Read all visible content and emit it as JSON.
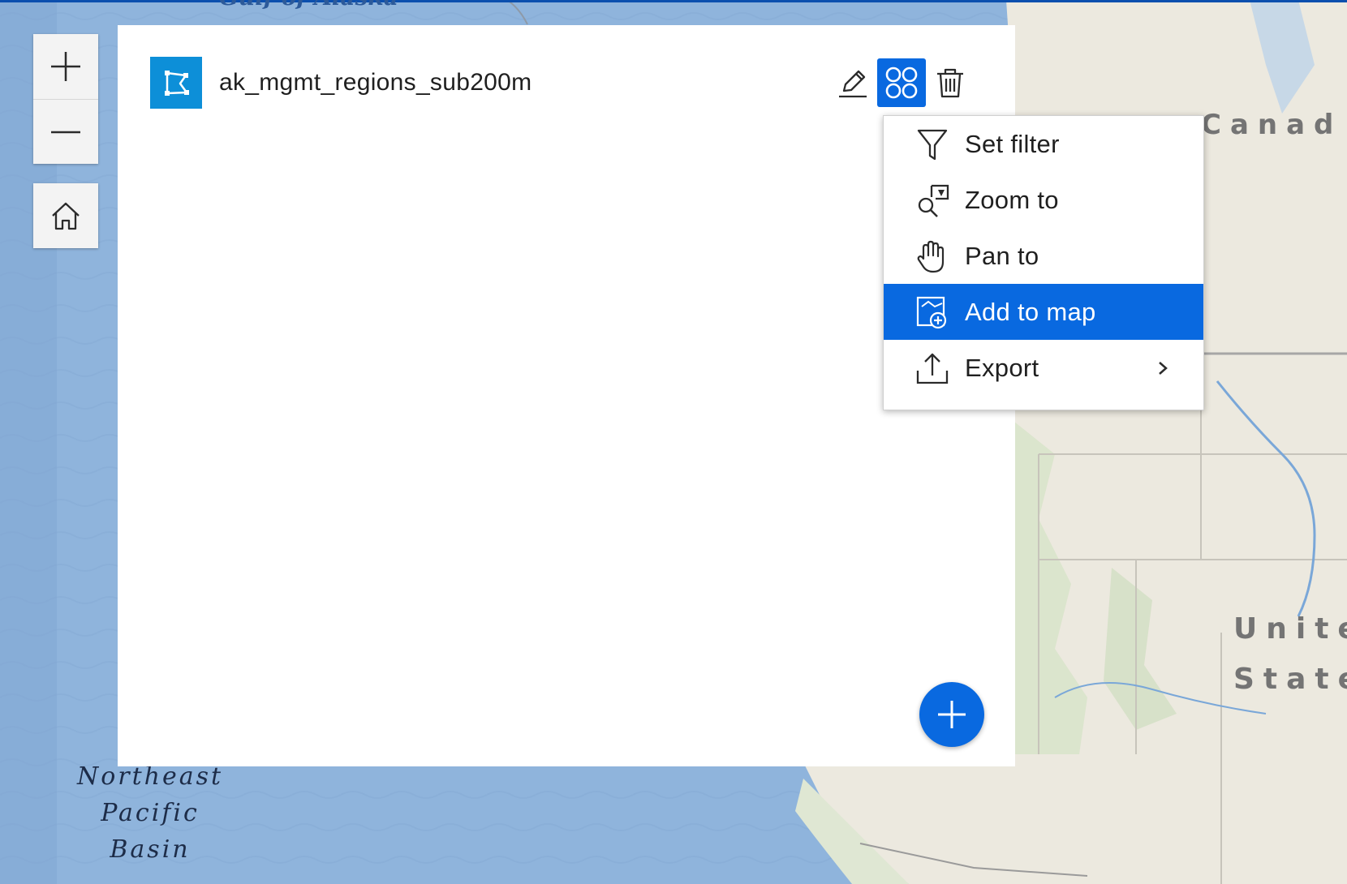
{
  "map": {
    "labels": {
      "gulf": "Gulf of Alaska",
      "canada": "Canad",
      "us_line1": "Unite",
      "us_line2": "State",
      "ocean_line1": "Northeast",
      "ocean_line2": "Pacific",
      "ocean_line3": "Basin"
    },
    "colors": {
      "ocean": "#8fb4dc",
      "land": "#ece9df",
      "accent": "#0969e0",
      "layer_thumb": "#0d8fd8"
    }
  },
  "controls": {
    "zoom_in_icon": "plus-icon",
    "zoom_out_icon": "minus-icon",
    "home_icon": "home-icon"
  },
  "panel": {
    "layer": {
      "name": "ak_mgmt_regions_sub200m",
      "thumbnail_icon": "polygon-icon",
      "actions": [
        {
          "id": "edit",
          "icon": "pencil-icon"
        },
        {
          "id": "more",
          "icon": "four-circles-icon",
          "active": true
        },
        {
          "id": "delete",
          "icon": "trash-icon"
        }
      ]
    },
    "add_button_icon": "plus-icon"
  },
  "menu": {
    "items": [
      {
        "label": "Set filter",
        "icon": "filter-icon"
      },
      {
        "label": "Zoom to",
        "icon": "zoom-to-icon"
      },
      {
        "label": "Pan to",
        "icon": "hand-icon"
      },
      {
        "label": "Add to map",
        "icon": "add-to-map-icon",
        "selected": true
      },
      {
        "label": "Export",
        "icon": "export-icon",
        "submenu": true
      }
    ]
  }
}
